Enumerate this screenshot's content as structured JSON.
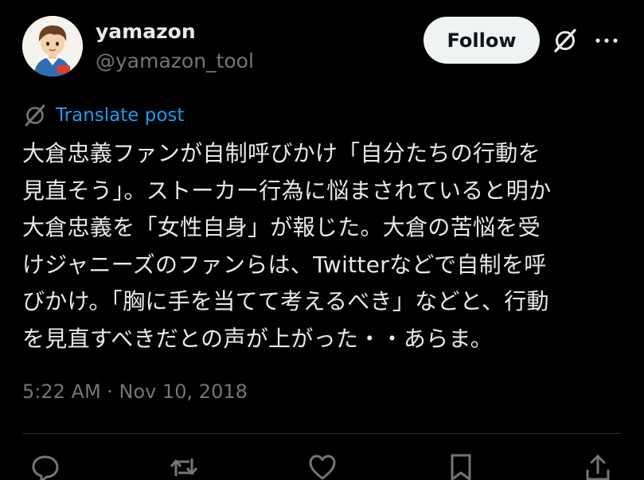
{
  "author": {
    "display_name": "yamazon",
    "handle": "@yamazon_tool"
  },
  "header": {
    "follow_label": "Follow",
    "grok_icon": "grok-icon",
    "more_icon": "more-icon"
  },
  "translate": {
    "icon": "translate-icon",
    "label": "Translate post"
  },
  "post": {
    "lines": [
      "大倉忠義ファンが自制呼びかけ「自分たちの行動を",
      "見直そう」。ストーカー行為に悩まされていると明か",
      "大倉忠義を「女性自身」が報じた。大倉の苦悩を受",
      "けジャニーズのファンらは、Twitterなどで自制を呼",
      "びかけ。「胸に手を当てて考えるべき」などと、行動",
      "を見直すべきだとの声が上がった・・あらま。"
    ],
    "timestamp": "5:22 AM · Nov 10, 2018"
  },
  "actions": {
    "reply_icon": "reply-icon",
    "repost_icon": "repost-icon",
    "like_icon": "like-icon",
    "bookmark_icon": "bookmark-icon",
    "share_icon": "share-icon"
  },
  "colors": {
    "background": "#000000",
    "text": "#e7e9ea",
    "muted": "#71767b",
    "link": "#1d9bf0",
    "follow_bg": "#eff3f4"
  }
}
